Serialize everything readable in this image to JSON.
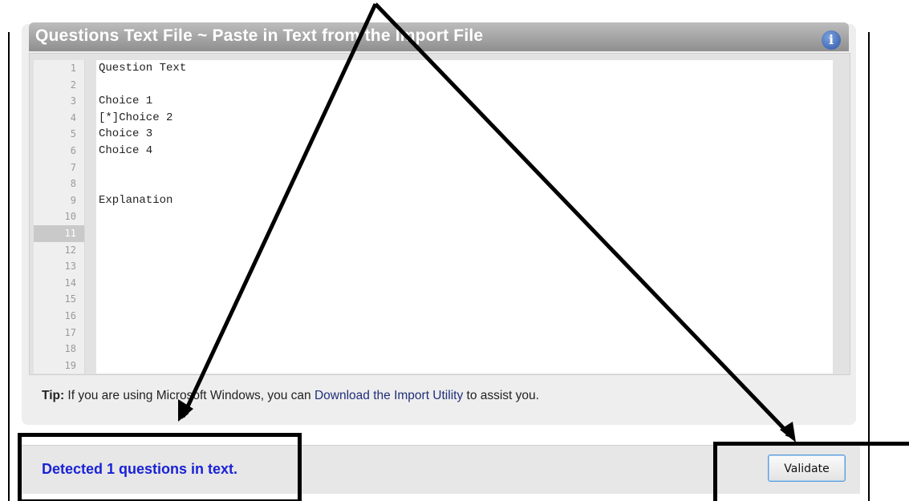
{
  "panel": {
    "title": "Questions Text File ~ Paste in Text from the Import File",
    "info_icon": "info-icon"
  },
  "editor": {
    "line_numbers": [
      "1",
      "2",
      "3",
      "4",
      "5",
      "6",
      "7",
      "8",
      "9",
      "10",
      "11",
      "12",
      "13",
      "14",
      "15",
      "16",
      "17",
      "18",
      "19"
    ],
    "active_line": "11",
    "lines": [
      "Question Text",
      "",
      "Choice 1",
      "[*]Choice 2",
      "Choice 3",
      "Choice 4",
      "",
      "",
      "Explanation",
      "",
      "",
      "",
      "",
      "",
      "",
      "",
      "",
      "",
      ""
    ]
  },
  "tip": {
    "label": "Tip:",
    "text": " If you are using Microsoft Windows, you can ",
    "link": "Download the Import Utility",
    "suffix": " to assist you."
  },
  "status": {
    "message": "Detected 1 questions in text."
  },
  "buttons": {
    "validate": "Validate"
  },
  "colors": {
    "status_text": "#1a22d6",
    "link": "#1f2f78",
    "header_gradient_top": "#bdbdbd",
    "header_gradient_bottom": "#8f8f8f"
  }
}
